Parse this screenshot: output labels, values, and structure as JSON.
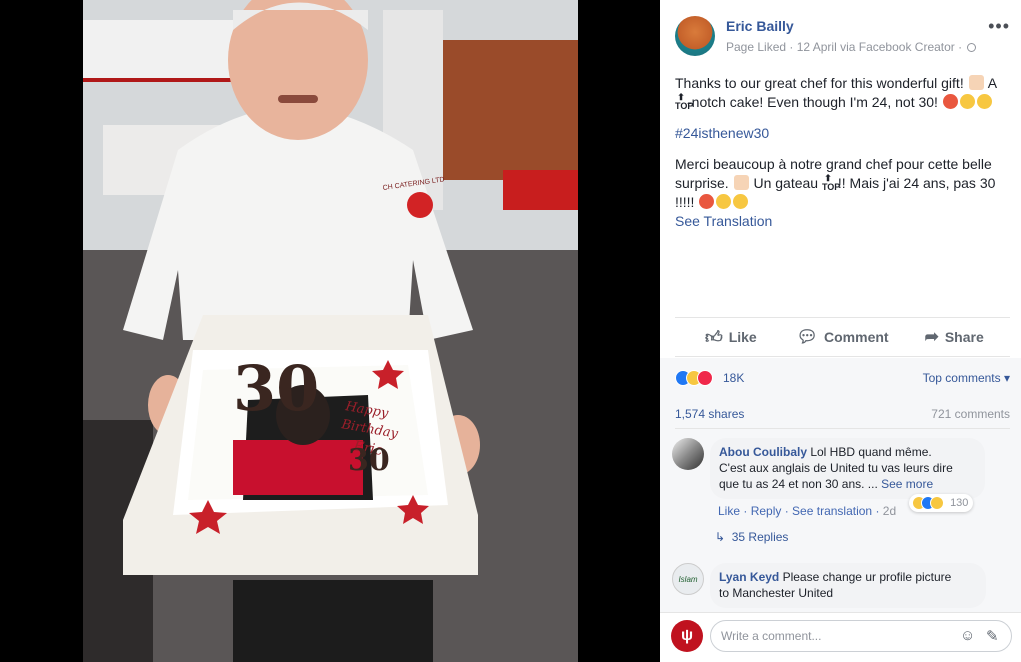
{
  "photo": {
    "cake_text_number": "30",
    "cake_text_happy": "Happy",
    "cake_text_birthday": "Birthday",
    "cake_text_name": "Eric",
    "chef_jacket_text": "CH CATERING LTD"
  },
  "post": {
    "page_name": "Eric Bailly",
    "meta": "Page Liked · 12 April via Facebook Creator · ",
    "line1a": "Thanks to our great chef for this wonderful gift! ",
    "line1b": " A ",
    "line1c": "-notch cake! Even though I'm 24, not 30! ",
    "hashtag": "#24isthenew30",
    "fr1": "Merci beaucoup à notre grand chef pour cette belle surprise. ",
    "fr2": " Un gateau ",
    "fr3": " !! Mais j'ai 24 ans, pas 30 !!!!! ",
    "top_glyph": "TOP",
    "see_translation": "See Translation"
  },
  "actions": {
    "like": "Like",
    "comment": "Comment",
    "share": "Share"
  },
  "stats": {
    "reactions_count": "18K",
    "top_comments": "Top comments ▾",
    "shares": "1,574 shares",
    "comments": "721 comments"
  },
  "comments": [
    {
      "name": "Abou Coulibaly",
      "text1": " Lol HBD quand même.",
      "text2": "C'est aux anglais de United tu vas leurs dire",
      "text3": "que tu as 24 et non 30 ans. ... ",
      "see_more": "See more",
      "like": "Like",
      "reply": "Reply",
      "see_translation": "See translation",
      "time": "2d",
      "reaction_count": "130",
      "replies": "35 Replies"
    },
    {
      "name": "Lyan Keyd",
      "text1": " Please change ur profile picture",
      "text2": "to Manchester United",
      "avatar_text": "Islam"
    }
  ],
  "composer": {
    "placeholder": "Write a comment..."
  },
  "colors": {
    "link": "#365899",
    "text": "#1d2129",
    "muted": "#90949c",
    "like_blue": "#2078f4",
    "love_red": "#f0284a",
    "haha_yellow": "#f7c741"
  }
}
